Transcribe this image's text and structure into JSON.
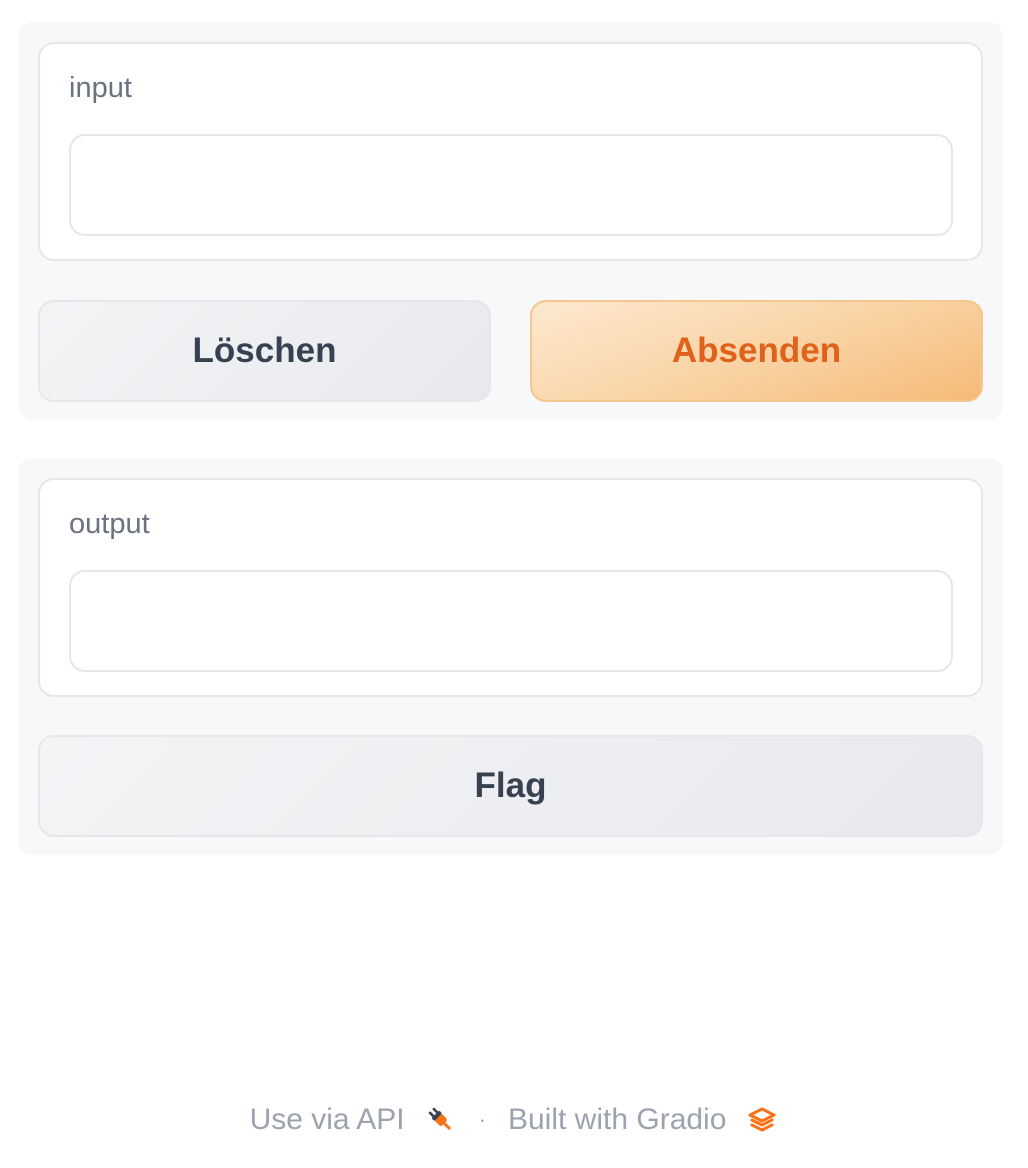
{
  "input_panel": {
    "label": "input",
    "value": "",
    "clear_button": "Löschen",
    "submit_button": "Absenden"
  },
  "output_panel": {
    "label": "output",
    "value": "",
    "flag_button": "Flag"
  },
  "footer": {
    "api_link": "Use via API",
    "api_icon": "plug-icon",
    "separator": "·",
    "built_with": "Built with Gradio",
    "gradio_icon": "gradio-logo-icon"
  },
  "colors": {
    "accent": "#e0611a",
    "primary_button_bg": "#f9d2a3",
    "panel_bg": "#f7f8fa",
    "border": "#e5e7eb",
    "label_text": "#6b7280",
    "button_text": "#374151"
  }
}
